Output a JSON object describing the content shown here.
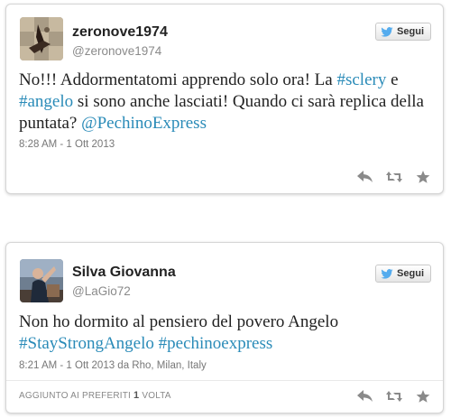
{
  "colors": {
    "link": "#2a8bb8",
    "icon": "#888888",
    "bird": "#55acee"
  },
  "follow_label": "Segui",
  "tweets": [
    {
      "display_name": "zeronove1974",
      "handle": "@zeronove1974",
      "text_parts": [
        {
          "t": "No!!! Addormentatomi apprendo solo ora! La ",
          "tag": false
        },
        {
          "t": "#sclery",
          "tag": true
        },
        {
          "t": " e ",
          "tag": false
        },
        {
          "t": "#angelo",
          "tag": true
        },
        {
          "t": " si sono anche lasciati! Quando ci sarà replica della puntata? ",
          "tag": false
        },
        {
          "t": "@PechinoExpress",
          "tag": true
        }
      ],
      "timestamp": "8:28 AM - 1 Ott 2013",
      "icons": [
        "reply-icon",
        "retweet-icon",
        "favorite-star-icon"
      ]
    },
    {
      "display_name": "Silva Giovanna",
      "handle": "@LaGio72",
      "text_parts": [
        {
          "t": "Non ho dormito al pensiero del povero Angelo ",
          "tag": false
        },
        {
          "t": "#StayStrongAngelo",
          "tag": true
        },
        {
          "t": " ",
          "tag": false
        },
        {
          "t": "#pechinoexpress",
          "tag": true
        }
      ],
      "timestamp": "8:21 AM - 1 Ott 2013 da Rho, Milan, Italy",
      "favorites_prefix": "AGGIUNTO AI PREFERITI",
      "favorites_count": "1",
      "favorites_suffix": "VOLTA",
      "icons": [
        "reply-icon",
        "retweet-icon",
        "favorite-star-icon"
      ]
    }
  ]
}
